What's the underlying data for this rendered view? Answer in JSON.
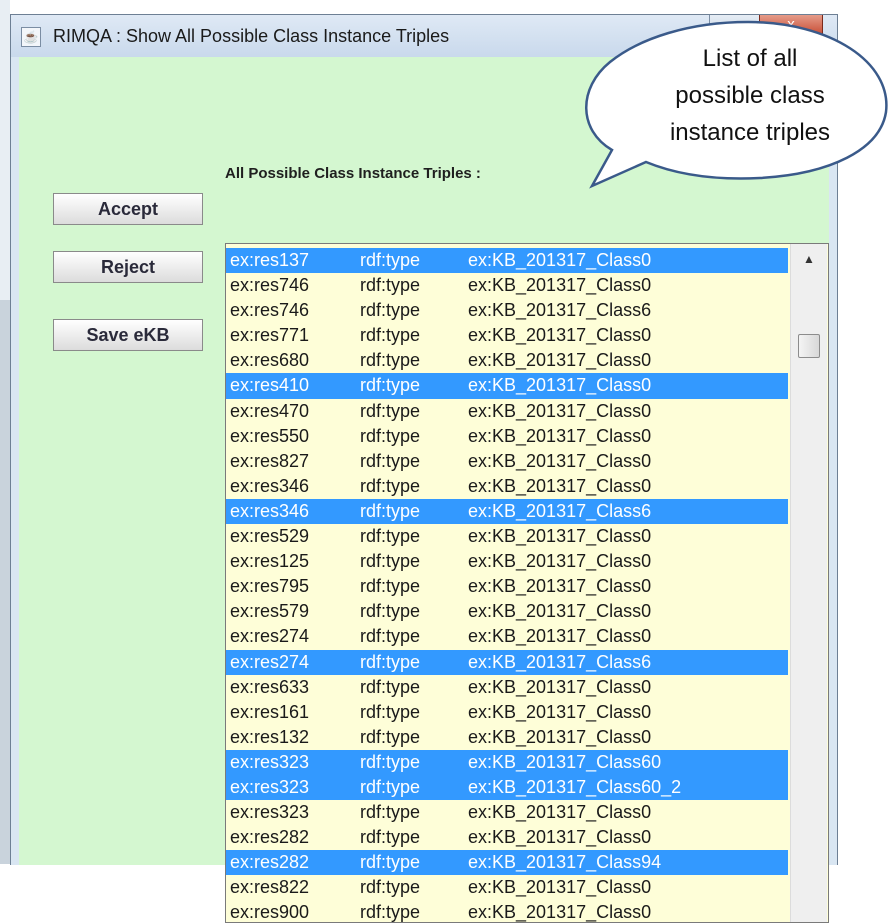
{
  "window": {
    "title": "RIMQA : Show All Possible Class Instance Triples",
    "close_label": "x"
  },
  "heading": "All Possible Class Instance Triples :",
  "buttons": {
    "accept": "Accept",
    "reject": "Reject",
    "save": "Save eKB"
  },
  "callout": {
    "line1": "List of all",
    "line2": "possible class",
    "line3": "instance triples"
  },
  "scrollbar": {
    "up_arrow": "▲"
  },
  "triples": [
    {
      "subject": "ex:res137",
      "predicate": "rdf:type",
      "object": "ex:KB_201317_Class0",
      "selected": true
    },
    {
      "subject": "ex:res746",
      "predicate": "rdf:type",
      "object": "ex:KB_201317_Class0",
      "selected": false
    },
    {
      "subject": "ex:res746",
      "predicate": "rdf:type",
      "object": "ex:KB_201317_Class6",
      "selected": false
    },
    {
      "subject": "ex:res771",
      "predicate": "rdf:type",
      "object": "ex:KB_201317_Class0",
      "selected": false
    },
    {
      "subject": "ex:res680",
      "predicate": "rdf:type",
      "object": "ex:KB_201317_Class0",
      "selected": false
    },
    {
      "subject": "ex:res410",
      "predicate": "rdf:type",
      "object": "ex:KB_201317_Class0",
      "selected": true
    },
    {
      "subject": "ex:res470",
      "predicate": "rdf:type",
      "object": "ex:KB_201317_Class0",
      "selected": false
    },
    {
      "subject": "ex:res550",
      "predicate": "rdf:type",
      "object": "ex:KB_201317_Class0",
      "selected": false
    },
    {
      "subject": "ex:res827",
      "predicate": "rdf:type",
      "object": "ex:KB_201317_Class0",
      "selected": false
    },
    {
      "subject": "ex:res346",
      "predicate": "rdf:type",
      "object": "ex:KB_201317_Class0",
      "selected": false
    },
    {
      "subject": "ex:res346",
      "predicate": "rdf:type",
      "object": "ex:KB_201317_Class6",
      "selected": true
    },
    {
      "subject": "ex:res529",
      "predicate": "rdf:type",
      "object": "ex:KB_201317_Class0",
      "selected": false
    },
    {
      "subject": "ex:res125",
      "predicate": "rdf:type",
      "object": "ex:KB_201317_Class0",
      "selected": false
    },
    {
      "subject": "ex:res795",
      "predicate": "rdf:type",
      "object": "ex:KB_201317_Class0",
      "selected": false
    },
    {
      "subject": "ex:res579",
      "predicate": "rdf:type",
      "object": "ex:KB_201317_Class0",
      "selected": false
    },
    {
      "subject": "ex:res274",
      "predicate": "rdf:type",
      "object": "ex:KB_201317_Class0",
      "selected": false
    },
    {
      "subject": "ex:res274",
      "predicate": "rdf:type",
      "object": "ex:KB_201317_Class6",
      "selected": true
    },
    {
      "subject": "ex:res633",
      "predicate": "rdf:type",
      "object": "ex:KB_201317_Class0",
      "selected": false
    },
    {
      "subject": "ex:res161",
      "predicate": "rdf:type",
      "object": "ex:KB_201317_Class0",
      "selected": false
    },
    {
      "subject": "ex:res132",
      "predicate": "rdf:type",
      "object": "ex:KB_201317_Class0",
      "selected": false
    },
    {
      "subject": "ex:res323",
      "predicate": "rdf:type",
      "object": "ex:KB_201317_Class60",
      "selected": true
    },
    {
      "subject": "ex:res323",
      "predicate": "rdf:type",
      "object": "ex:KB_201317_Class60_2",
      "selected": true
    },
    {
      "subject": "ex:res323",
      "predicate": "rdf:type",
      "object": "ex:KB_201317_Class0",
      "selected": false
    },
    {
      "subject": "ex:res282",
      "predicate": "rdf:type",
      "object": "ex:KB_201317_Class0",
      "selected": false
    },
    {
      "subject": "ex:res282",
      "predicate": "rdf:type",
      "object": "ex:KB_201317_Class94",
      "selected": true
    },
    {
      "subject": "ex:res822",
      "predicate": "rdf:type",
      "object": "ex:KB_201317_Class0",
      "selected": false
    },
    {
      "subject": "ex:res900",
      "predicate": "rdf:type",
      "object": "ex:KB_201317_Class0",
      "selected": false
    }
  ]
}
